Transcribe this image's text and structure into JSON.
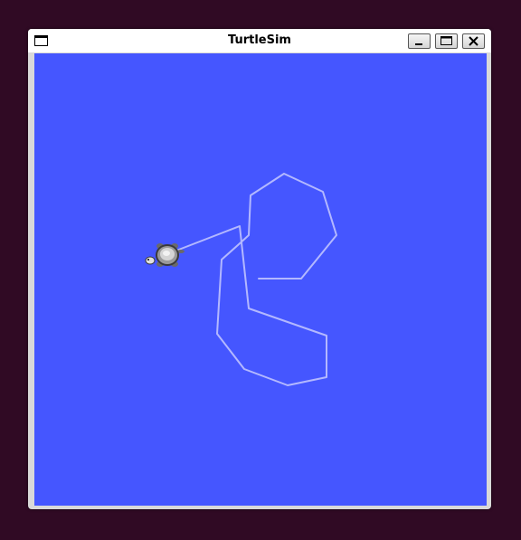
{
  "window": {
    "title": "TurtleSim",
    "buttons": {
      "minimize": "minimize",
      "maximize": "maximize",
      "close": "close"
    }
  },
  "canvas": {
    "background_color": "#4556ff",
    "pen_color": "#b3b8ff"
  },
  "turtle": {
    "icon": "turtle-icon",
    "shell_color": "#cfcfcf",
    "outline_color": "#3a3a3a"
  }
}
